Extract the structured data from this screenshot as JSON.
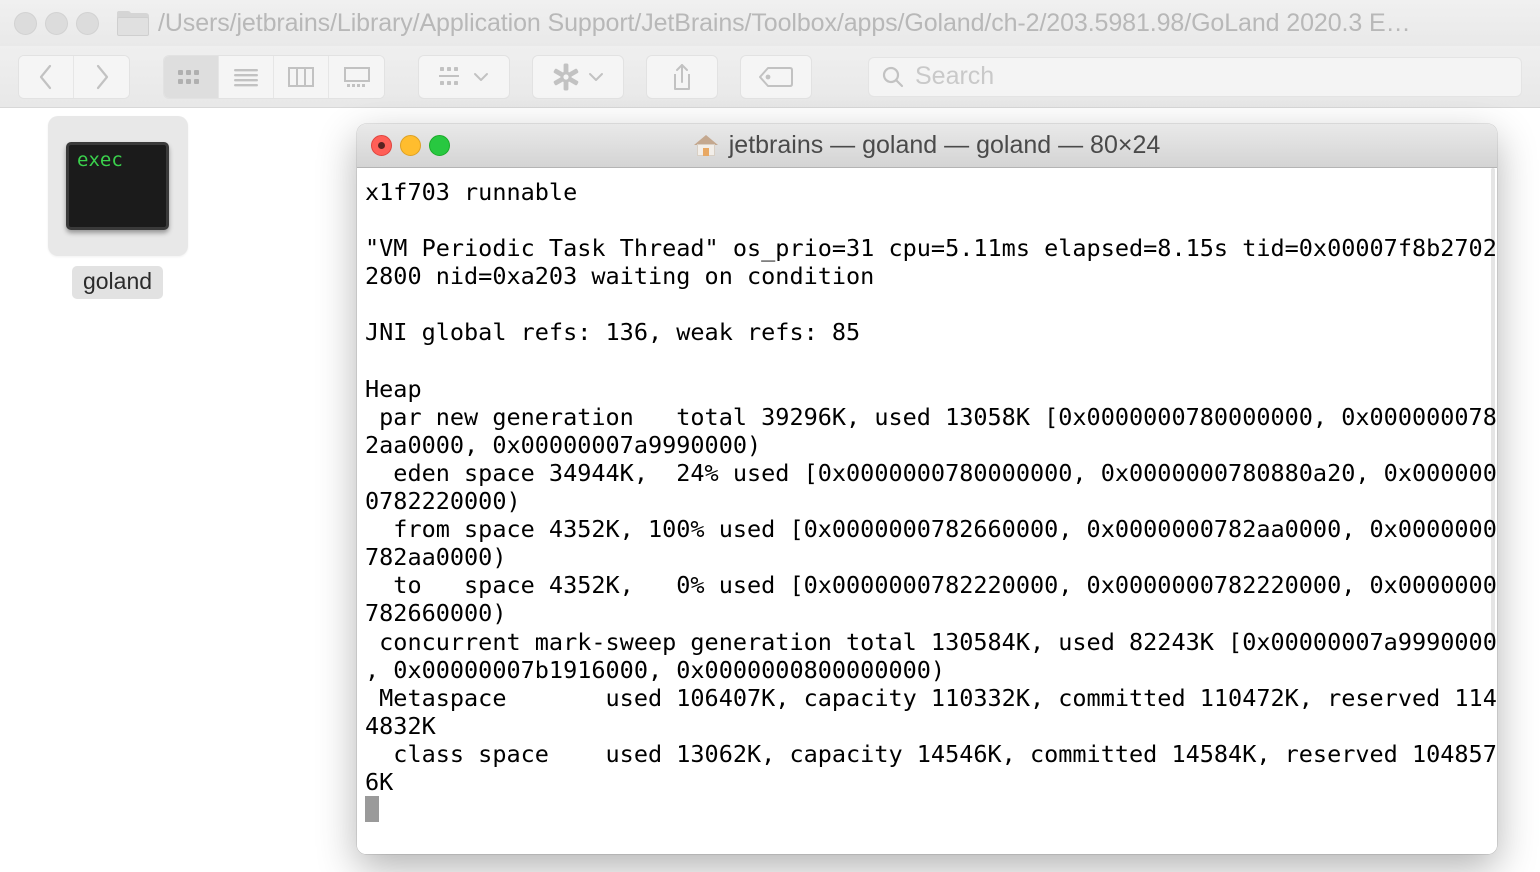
{
  "finder": {
    "path_title": "/Users/jetbrains/Library/Application Support/JetBrains/Toolbox/apps/Goland/ch-2/203.5981.98/GoLand 2020.3 E…",
    "traffic_lights": [
      "close",
      "minimize",
      "zoom"
    ],
    "toolbar": {
      "back_label": "‹",
      "forward_label": "›",
      "view_icon_grid": "icon-view-button",
      "view_icon_list": "list-view-button",
      "view_icon_column": "column-view-button",
      "view_icon_gallery": "gallery-view-button",
      "group_label": "group-by-button",
      "action_label": "action-gear-button",
      "share_label": "share-button",
      "tags_label": "tags-button",
      "chevron": "˅"
    },
    "search": {
      "placeholder": "Search",
      "icon": "search-icon"
    },
    "files": [
      {
        "name": "goland",
        "icon_type": "unix-executable",
        "icon_text": "exec"
      }
    ]
  },
  "terminal": {
    "title": "jetbrains — goland — goland — 80×24",
    "title_icon": "home-icon",
    "traffic_lights": [
      "close",
      "minimize",
      "zoom"
    ],
    "size": "80×24",
    "content": "x1f703 runnable\n\n\"VM Periodic Task Thread\" os_prio=31 cpu=5.11ms elapsed=8.15s tid=0x00007f8b2702\n2800 nid=0xa203 waiting on condition\n\nJNI global refs: 136, weak refs: 85\n\nHeap\n par new generation   total 39296K, used 13058K [0x0000000780000000, 0x000000078\n2aa0000, 0x00000007a9990000)\n  eden space 34944K,  24% used [0x0000000780000000, 0x0000000780880a20, 0x000000\n0782220000)\n  from space 4352K, 100% used [0x0000000782660000, 0x0000000782aa0000, 0x0000000\n782aa0000)\n  to   space 4352K,   0% used [0x0000000782220000, 0x0000000782220000, 0x0000000\n782660000)\n concurrent mark-sweep generation total 130584K, used 82243K [0x00000007a9990000\n, 0x00000007b1916000, 0x0000000800000000)\n Metaspace       used 106407K, capacity 110332K, committed 110472K, reserved 114\n4832K\n  class space    used 13062K, capacity 14546K, committed 14584K, reserved 104857\n6K",
    "cursor": "block-cursor"
  }
}
